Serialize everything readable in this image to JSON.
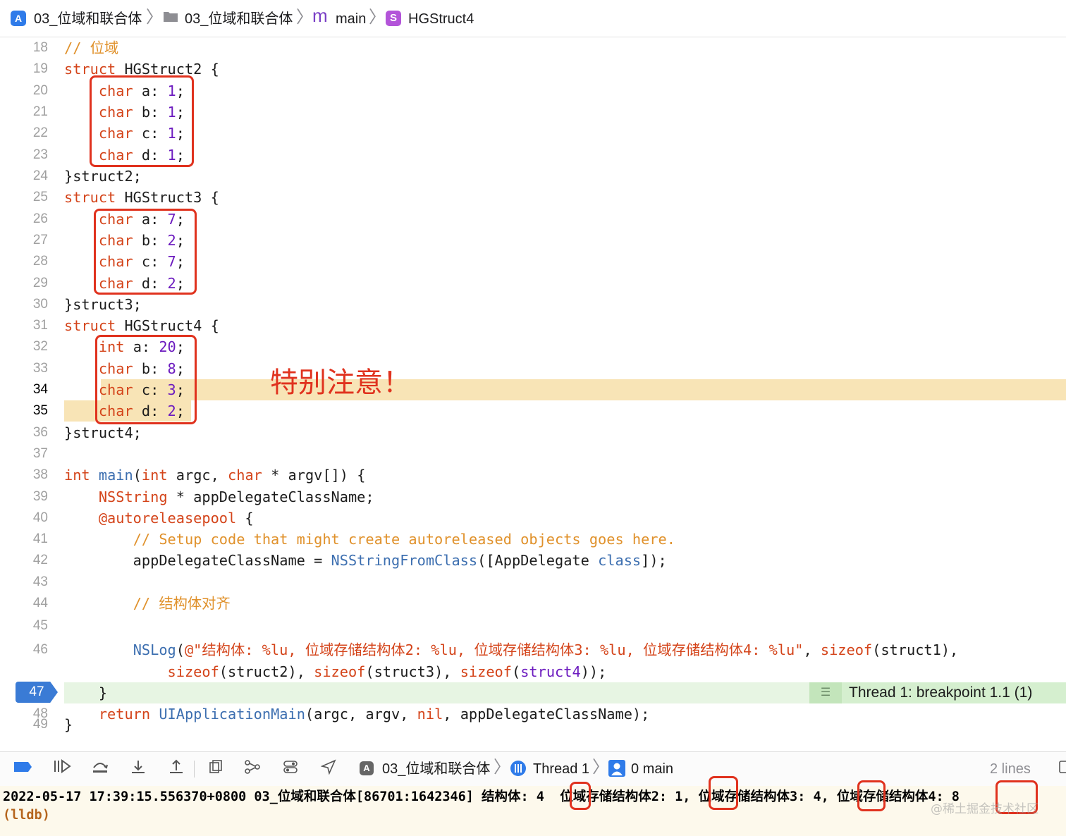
{
  "breadcrumb": {
    "project": "03_位域和联合体",
    "group": "03_位域和联合体",
    "file_badge": "m",
    "file": "main",
    "symbol_badge": "S",
    "symbol": "HGStruct4"
  },
  "annotation": "特别注意！",
  "breakpoint_line": "47",
  "thread_label": "Thread 1: breakpoint 1.1 (1)",
  "debug_bar": {
    "target": "03_位域和联合体",
    "thread": "Thread 1",
    "frame": "0 main",
    "lines": "2 lines"
  },
  "console": {
    "line1": "2022-05-17 17:39:15.556370+0800 03_位域和联合体[86701:1642346] 结构体: 4  位域存储结构体2: 1, 位域存储结构体3: 4, 位域存储结构体4: 8",
    "line2": "(lldb)"
  },
  "watermark": "@稀土掘金技术社区",
  "code_lines": [
    {
      "n": "18",
      "segs": [
        {
          "t": "// 位域",
          "c": "com"
        }
      ]
    },
    {
      "n": "19",
      "segs": [
        {
          "t": "struct",
          "c": "kw"
        },
        {
          "t": " HGStruct2 {",
          "c": ""
        }
      ]
    },
    {
      "n": "20",
      "segs": [
        {
          "t": "    ",
          "c": ""
        },
        {
          "t": "char",
          "c": "kw"
        },
        {
          "t": " a: ",
          "c": ""
        },
        {
          "t": "1",
          "c": "num"
        },
        {
          "t": ";",
          "c": ""
        }
      ]
    },
    {
      "n": "21",
      "segs": [
        {
          "t": "    ",
          "c": ""
        },
        {
          "t": "char",
          "c": "kw"
        },
        {
          "t": " b: ",
          "c": ""
        },
        {
          "t": "1",
          "c": "num"
        },
        {
          "t": ";",
          "c": ""
        }
      ]
    },
    {
      "n": "22",
      "segs": [
        {
          "t": "    ",
          "c": ""
        },
        {
          "t": "char",
          "c": "kw"
        },
        {
          "t": " c: ",
          "c": ""
        },
        {
          "t": "1",
          "c": "num"
        },
        {
          "t": ";",
          "c": ""
        }
      ]
    },
    {
      "n": "23",
      "segs": [
        {
          "t": "    ",
          "c": ""
        },
        {
          "t": "char",
          "c": "kw"
        },
        {
          "t": " d: ",
          "c": ""
        },
        {
          "t": "1",
          "c": "num"
        },
        {
          "t": ";",
          "c": ""
        }
      ]
    },
    {
      "n": "24",
      "segs": [
        {
          "t": "}struct2;",
          "c": ""
        }
      ]
    },
    {
      "n": "25",
      "segs": [
        {
          "t": "struct",
          "c": "kw"
        },
        {
          "t": " HGStruct3 {",
          "c": ""
        }
      ]
    },
    {
      "n": "26",
      "segs": [
        {
          "t": "    ",
          "c": ""
        },
        {
          "t": "char",
          "c": "kw"
        },
        {
          "t": " a: ",
          "c": ""
        },
        {
          "t": "7",
          "c": "num"
        },
        {
          "t": ";",
          "c": ""
        }
      ]
    },
    {
      "n": "27",
      "segs": [
        {
          "t": "    ",
          "c": ""
        },
        {
          "t": "char",
          "c": "kw"
        },
        {
          "t": " b: ",
          "c": ""
        },
        {
          "t": "2",
          "c": "num"
        },
        {
          "t": ";",
          "c": ""
        }
      ]
    },
    {
      "n": "28",
      "segs": [
        {
          "t": "    ",
          "c": ""
        },
        {
          "t": "char",
          "c": "kw"
        },
        {
          "t": " c: ",
          "c": ""
        },
        {
          "t": "7",
          "c": "num"
        },
        {
          "t": ";",
          "c": ""
        }
      ]
    },
    {
      "n": "29",
      "segs": [
        {
          "t": "    ",
          "c": ""
        },
        {
          "t": "char",
          "c": "kw"
        },
        {
          "t": " d: ",
          "c": ""
        },
        {
          "t": "2",
          "c": "num"
        },
        {
          "t": ";",
          "c": ""
        }
      ]
    },
    {
      "n": "30",
      "segs": [
        {
          "t": "}struct3;",
          "c": ""
        }
      ]
    },
    {
      "n": "31",
      "segs": [
        {
          "t": "struct",
          "c": "kw"
        },
        {
          "t": " HGStruct4 {",
          "c": ""
        }
      ]
    },
    {
      "n": "32",
      "segs": [
        {
          "t": "    ",
          "c": ""
        },
        {
          "t": "int",
          "c": "kw"
        },
        {
          "t": " a: ",
          "c": ""
        },
        {
          "t": "20",
          "c": "num"
        },
        {
          "t": ";",
          "c": ""
        }
      ]
    },
    {
      "n": "33",
      "segs": [
        {
          "t": "    ",
          "c": ""
        },
        {
          "t": "char",
          "c": "kw"
        },
        {
          "t": " b: ",
          "c": ""
        },
        {
          "t": "8",
          "c": "num"
        },
        {
          "t": ";",
          "c": ""
        }
      ]
    },
    {
      "n": "34",
      "segs": [
        {
          "t": "    ",
          "c": ""
        },
        {
          "t": "char",
          "c": "kw"
        },
        {
          "t": " c: ",
          "c": ""
        },
        {
          "t": "3",
          "c": "num"
        },
        {
          "t": ";",
          "c": ""
        }
      ]
    },
    {
      "n": "35",
      "segs": [
        {
          "t": "    ",
          "c": ""
        },
        {
          "t": "char",
          "c": "kw"
        },
        {
          "t": " d: ",
          "c": ""
        },
        {
          "t": "2",
          "c": "num"
        },
        {
          "t": ";",
          "c": ""
        }
      ]
    },
    {
      "n": "36",
      "segs": [
        {
          "t": "}struct4;",
          "c": ""
        }
      ]
    },
    {
      "n": "37",
      "segs": []
    },
    {
      "n": "38",
      "segs": [
        {
          "t": "int",
          "c": "kw"
        },
        {
          "t": " ",
          "c": ""
        },
        {
          "t": "main",
          "c": "fn"
        },
        {
          "t": "(",
          "c": ""
        },
        {
          "t": "int",
          "c": "kw"
        },
        {
          "t": " argc, ",
          "c": ""
        },
        {
          "t": "char",
          "c": "kw"
        },
        {
          "t": " * argv[]) {",
          "c": ""
        }
      ]
    },
    {
      "n": "39",
      "segs": [
        {
          "t": "    ",
          "c": ""
        },
        {
          "t": "NSString",
          "c": "kw"
        },
        {
          "t": " * appDelegateClassName;",
          "c": ""
        }
      ]
    },
    {
      "n": "40",
      "segs": [
        {
          "t": "    ",
          "c": ""
        },
        {
          "t": "@autoreleasepool",
          "c": "kw"
        },
        {
          "t": " {",
          "c": ""
        }
      ]
    },
    {
      "n": "41",
      "segs": [
        {
          "t": "        ",
          "c": ""
        },
        {
          "t": "// Setup code that might create autoreleased objects goes here.",
          "c": "com"
        }
      ]
    },
    {
      "n": "42",
      "segs": [
        {
          "t": "        appDelegateClassName = ",
          "c": ""
        },
        {
          "t": "NSStringFromClass",
          "c": "fn"
        },
        {
          "t": "([AppDelegate ",
          "c": ""
        },
        {
          "t": "class",
          "c": "fn"
        },
        {
          "t": "]);",
          "c": ""
        }
      ]
    },
    {
      "n": "43",
      "segs": []
    },
    {
      "n": "44",
      "segs": [
        {
          "t": "        ",
          "c": ""
        },
        {
          "t": "// 结构体对齐",
          "c": "com"
        }
      ]
    },
    {
      "n": "45",
      "segs": []
    },
    {
      "n": "46",
      "segs": [
        {
          "t": "        ",
          "c": ""
        },
        {
          "t": "NSLog",
          "c": "fn"
        },
        {
          "t": "(",
          "c": ""
        },
        {
          "t": "@\"结构体: %lu, 位域存储结构体2: %lu, 位域存储结构体3: %lu, 位域存储结构体4: %lu\"",
          "c": "str"
        },
        {
          "t": ", ",
          "c": ""
        },
        {
          "t": "sizeof",
          "c": "kw"
        },
        {
          "t": "(struct1),",
          "c": ""
        }
      ]
    },
    {
      "n": "",
      "segs": [
        {
          "t": "            ",
          "c": ""
        },
        {
          "t": "sizeof",
          "c": "kw"
        },
        {
          "t": "(struct2), ",
          "c": ""
        },
        {
          "t": "sizeof",
          "c": "kw"
        },
        {
          "t": "(struct3), ",
          "c": ""
        },
        {
          "t": "sizeof",
          "c": "kw"
        },
        {
          "t": "(",
          "c": ""
        },
        {
          "t": "struct4",
          "c": "num"
        },
        {
          "t": "));",
          "c": ""
        }
      ]
    },
    {
      "n": "47",
      "segs": [
        {
          "t": "    }",
          "c": ""
        }
      ]
    },
    {
      "n": "48",
      "segs": [
        {
          "t": "    ",
          "c": ""
        },
        {
          "t": "return",
          "c": "kw"
        },
        {
          "t": " ",
          "c": ""
        },
        {
          "t": "UIApplicationMain",
          "c": "fn"
        },
        {
          "t": "(argc, argv, ",
          "c": ""
        },
        {
          "t": "nil",
          "c": "kw"
        },
        {
          "t": ", appDelegateClassName);",
          "c": ""
        }
      ]
    },
    {
      "n": "49",
      "segs": [
        {
          "t": "}",
          "c": ""
        }
      ]
    }
  ]
}
